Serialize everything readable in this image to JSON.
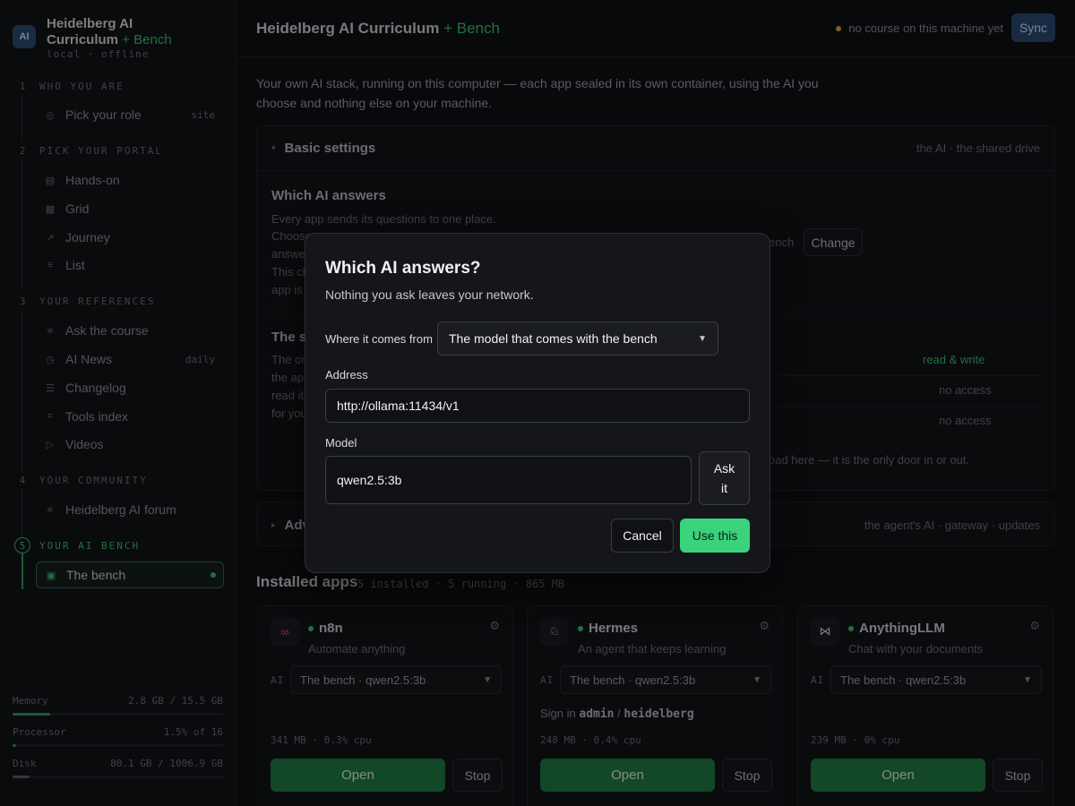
{
  "brand": {
    "badge": "AI",
    "title_main": "Heidelberg AI Curriculum",
    "title_accent": "+ Bench",
    "subtitle": "local · offline"
  },
  "sidebar": {
    "sections": [
      {
        "num": "1",
        "label": "WHO YOU ARE"
      },
      {
        "num": "2",
        "label": "PICK YOUR PORTAL"
      },
      {
        "num": "3",
        "label": "YOUR REFERENCES"
      },
      {
        "num": "4",
        "label": "YOUR COMMUNITY"
      },
      {
        "num": "5",
        "label": "YOUR AI BENCH"
      }
    ],
    "items": [
      {
        "label": "Pick your role",
        "tag": "site",
        "icon": "target-icon",
        "glyph": "◎"
      },
      {
        "label": "Hands-on",
        "icon": "grid-list-icon",
        "glyph": "▤"
      },
      {
        "label": "Grid",
        "icon": "grid-icon",
        "glyph": "▦"
      },
      {
        "label": "Journey",
        "icon": "arrow-up-right-icon",
        "glyph": "↗"
      },
      {
        "label": "List",
        "icon": "list-icon",
        "glyph": "≡"
      },
      {
        "label": "Ask the course",
        "icon": "sparkle-icon",
        "glyph": "✳"
      },
      {
        "label": "AI News",
        "tag": "daily",
        "icon": "clock-icon",
        "glyph": "◷"
      },
      {
        "label": "Changelog",
        "icon": "lines-icon",
        "glyph": "☰"
      },
      {
        "label": "Tools index",
        "icon": "frame-icon",
        "glyph": "⌗"
      },
      {
        "label": "Videos",
        "icon": "play-icon",
        "glyph": "▷"
      },
      {
        "label": "Heidelberg AI forum",
        "icon": "star-icon",
        "glyph": "✳"
      },
      {
        "label": "The bench",
        "icon": "bench-icon",
        "glyph": "▣"
      }
    ],
    "stats": [
      {
        "label": "Memory",
        "value": "2.8 GB / 15.5 GB",
        "fraction": 0.18,
        "color": "#2f9e5a"
      },
      {
        "label": "Processor",
        "value": "1.5% of 16",
        "fraction": 0.015,
        "color": "#2f9e5a"
      },
      {
        "label": "Disk",
        "value": "80.1 GB / 1006.9 GB",
        "fraction": 0.08,
        "color": "#5a5d66"
      }
    ]
  },
  "header": {
    "title_main": "Heidelberg AI Curriculum",
    "title_accent": "+ Bench",
    "status": "no course on this machine yet",
    "sync_label": "Sync"
  },
  "intro": "Your own AI stack, running on this computer — each app sealed in its own container, using the AI you choose and nothing else on your machine.",
  "basic": {
    "title": "Basic settings",
    "right": "the AI · the shared drive",
    "which_ai": {
      "title": "Which AI answers",
      "l1": "Every app sends its questions to one place.",
      "l2": "Choose",
      "l3": "answe",
      "l4": "This ch",
      "l5": "app is",
      "bench_peek": "ench",
      "change_label": "Change"
    },
    "shared": {
      "title_peek": "The s",
      "l1": "The or",
      "l2": "the ap",
      "l3": "read it",
      "l4": "for you",
      "perm1": "read & write",
      "perm2": "no access",
      "perm3": "no access",
      "footer_peek": "oad here — it is the only door in or out."
    }
  },
  "advanced": {
    "title_peek": "Adv",
    "right": "the agent's AI · gateway · updates"
  },
  "apps": {
    "title": "Installed apps",
    "meta": "5 installed · 5 running · 865 MB",
    "ai_label": "AI",
    "open_label": "Open",
    "stop_label": "Stop",
    "cards": [
      {
        "name": "n8n",
        "desc": "Automate anything",
        "model": "The bench · qwen2.5:3b",
        "usage": "341 MB · 0.3% cpu",
        "logo": "n8n-logo-icon",
        "signin": false
      },
      {
        "name": "Hermes",
        "desc": "An agent that keeps learning",
        "model": "The bench · qwen2.5:3b",
        "usage": "248 MB · 0.4% cpu",
        "logo": "hermes-logo-icon",
        "signin": true,
        "signin_prefix": "Sign in",
        "user": "admin",
        "sep": "/",
        "pass": "heidelberg"
      },
      {
        "name": "AnythingLLM",
        "desc": "Chat with your documents",
        "model": "The bench · qwen2.5:3b",
        "usage": "239 MB · 0% cpu",
        "logo": "anythingllm-logo-icon",
        "signin": false
      }
    ]
  },
  "modal": {
    "title": "Which AI answers?",
    "subtitle": "Nothing you ask leaves your network.",
    "source_label": "Where it comes from",
    "source_value": "The model that comes with the bench",
    "address_label": "Address",
    "address_value": "http://ollama:11434/v1",
    "model_label": "Model",
    "model_value": "qwen2.5:3b",
    "ask_label_1": "Ask",
    "ask_label_2": "it",
    "cancel_label": "Cancel",
    "use_label": "Use this"
  },
  "colors": {
    "accent": "#3fbf6e",
    "primary_button": "#3ad27a",
    "sync_bg": "#2c4a73",
    "status_dot": "#d9a93a"
  }
}
